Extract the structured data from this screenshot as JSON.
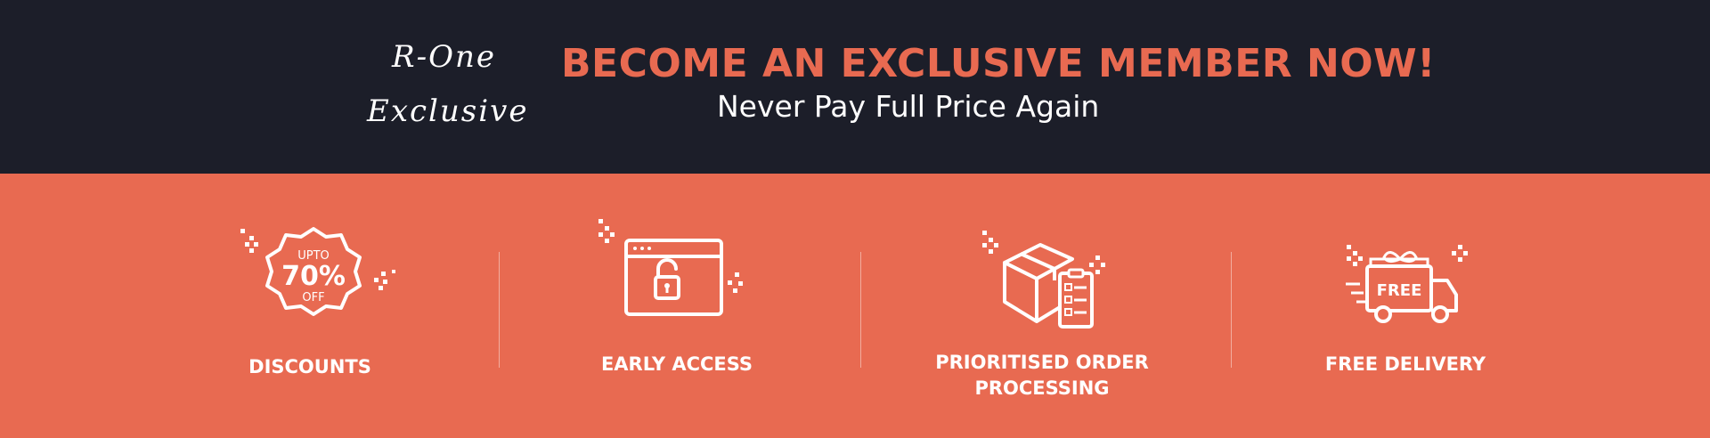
{
  "brand": {
    "line1": "R-One",
    "line2": "Exclusive"
  },
  "banner": {
    "headline": "BECOME AN EXCLUSIVE MEMBER NOW!",
    "subheadline": "Never Pay Full Price Again"
  },
  "colors": {
    "dark_background": "#1c1e29",
    "accent": "#e86a51",
    "text_light": "#ffffff"
  },
  "features": [
    {
      "icon": "discount-badge-icon",
      "badge_top": "UPTO",
      "badge_value": "70%",
      "badge_bottom": "OFF",
      "label": "DISCOUNTS"
    },
    {
      "icon": "unlock-window-icon",
      "label": "EARLY ACCESS"
    },
    {
      "icon": "package-checklist-icon",
      "label_line1": "PRIORITISED ORDER",
      "label_line2": "PROCESSING"
    },
    {
      "icon": "delivery-truck-icon",
      "truck_text": "FREE",
      "label": "FREE DELIVERY"
    }
  ]
}
